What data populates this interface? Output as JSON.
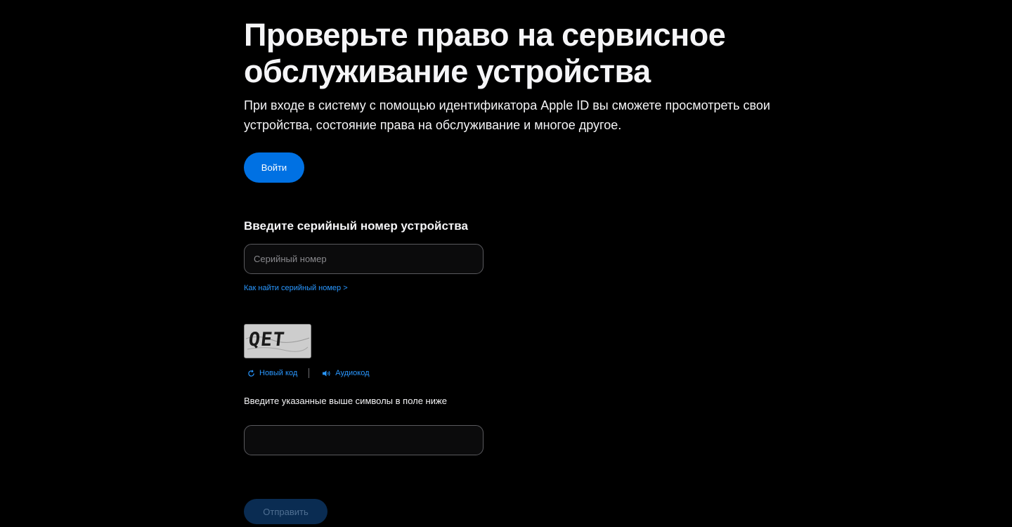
{
  "header": {
    "title": "Проверьте право на сервисное обслуживание устройства",
    "subtitle": "При входе в систему с помощью идентификатора Apple ID вы сможете просмотреть свои устройства, состояние права на обслуживание и многое другое."
  },
  "signin": {
    "label": "Войти"
  },
  "serial": {
    "heading": "Введите серийный номер устройства",
    "placeholder": "Серийный номер",
    "value": "",
    "help_link": "Как найти серийный номер >"
  },
  "captcha": {
    "image_text": "QET",
    "new_code_label": "Новый код",
    "new_code_icon": "refresh-icon",
    "audio_code_label": "Аудиокод",
    "audio_code_icon": "speaker-icon",
    "instruction": "Введите указанные выше символы в поле ниже",
    "input_value": ""
  },
  "submit": {
    "label": "Отправить"
  },
  "colors": {
    "background": "#000000",
    "accent": "#0071e3",
    "link": "#2997ff",
    "submit_disabled_bg": "#0a2c52"
  }
}
